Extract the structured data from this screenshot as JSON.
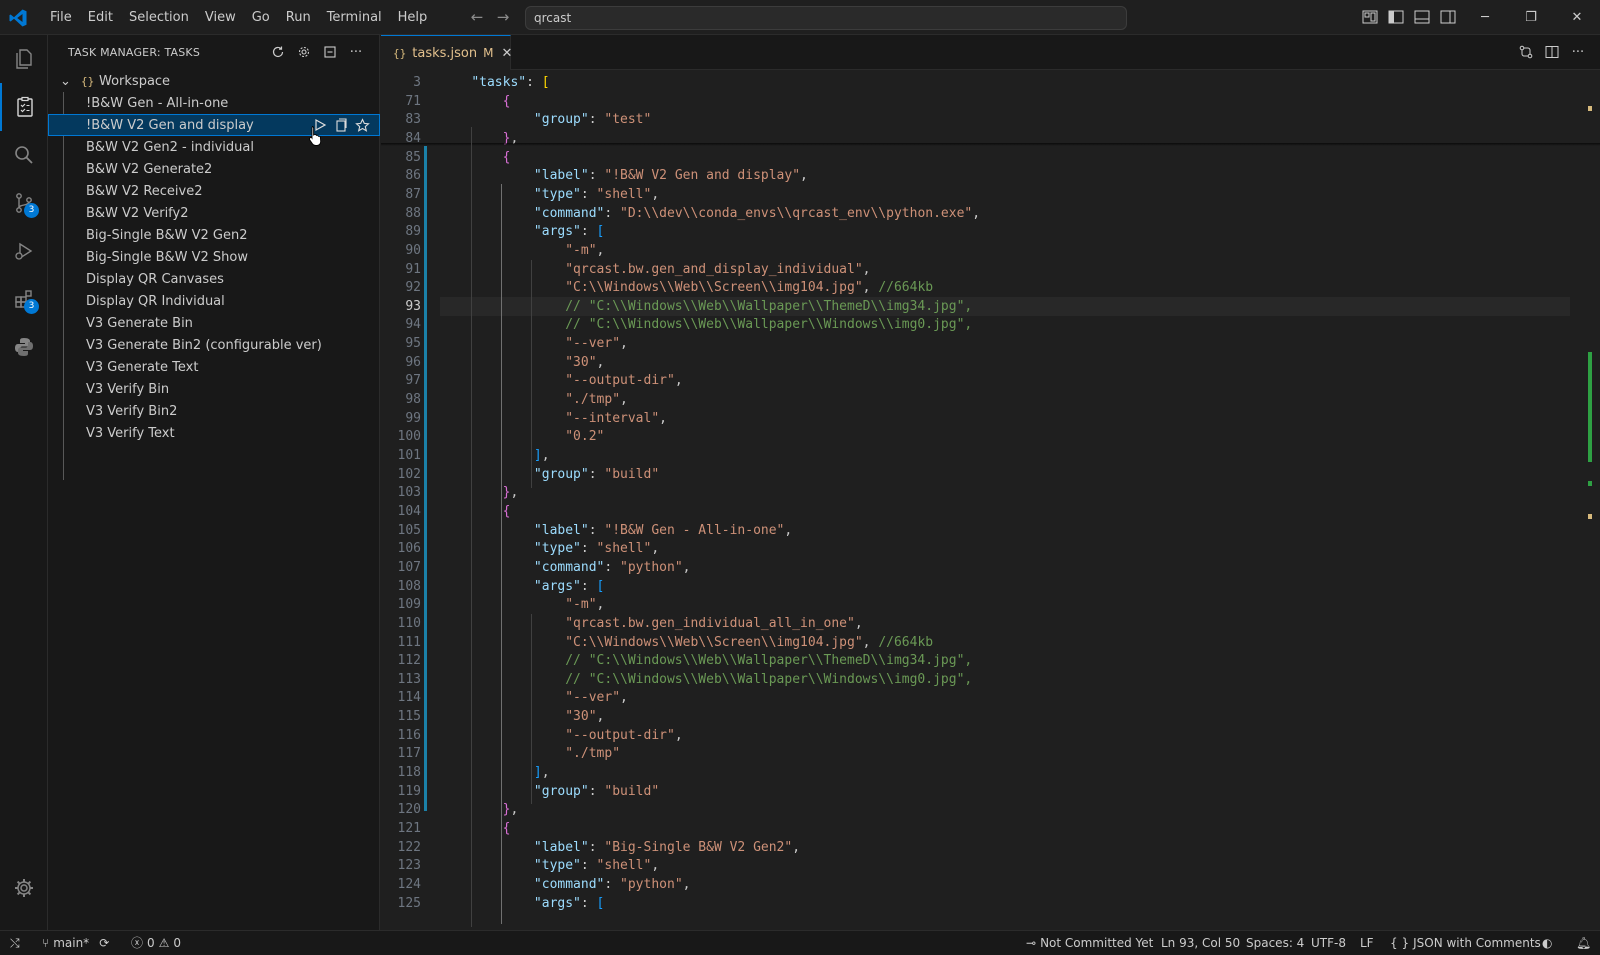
{
  "menu": [
    "File",
    "Edit",
    "Selection",
    "View",
    "Go",
    "Run",
    "Terminal",
    "Help"
  ],
  "search": {
    "value": "qrcast"
  },
  "colors": {
    "accent": "#0078d4",
    "background": "#1f1f1f",
    "sidebar": "#181818",
    "modified": "#e2c08d",
    "selection": "#04395e"
  },
  "activitybar": {
    "items": [
      {
        "name": "explorer-icon"
      },
      {
        "name": "task-manager-icon",
        "active": true
      },
      {
        "name": "search-icon"
      },
      {
        "name": "source-control-icon",
        "badge": "3"
      },
      {
        "name": "run-debug-icon"
      },
      {
        "name": "extensions-icon",
        "badge": "3"
      },
      {
        "name": "python-icon"
      }
    ],
    "settings": "gear-icon"
  },
  "sidebar": {
    "title": "TASK MANAGER: TASKS",
    "root": "Workspace",
    "tasks": [
      "!B&W Gen - All-in-one",
      "!B&W V2 Gen and display",
      "B&W V2 Gen2 - individual",
      "B&W V2 Generate2",
      "B&W V2 Receive2",
      "B&W V2 Verify2",
      "Big-Single B&W V2 Gen2",
      "Big-Single B&W V2 Show",
      "Display QR Canvases",
      "Display QR Individual",
      "V3 Generate Bin",
      "V3 Generate Bin2 (configurable ver)",
      "V3 Generate Text",
      "V3 Verify Bin",
      "V3 Verify Bin2",
      "V3 Verify Text"
    ],
    "selected_index": 1
  },
  "editor": {
    "tab": {
      "icon": "{}",
      "name": "tasks.json",
      "status": "M"
    },
    "current_line": 93,
    "lines": [
      {
        "n": "3",
        "segs": [
          [
            "p",
            "    "
          ],
          [
            "k",
            "\"tasks\""
          ],
          [
            "p",
            ": "
          ],
          [
            "b1",
            "["
          ]
        ]
      },
      {
        "n": "71",
        "segs": [
          [
            "p",
            "        "
          ],
          [
            "b2",
            "{"
          ]
        ]
      },
      {
        "n": "83",
        "segs": [
          [
            "p",
            "            "
          ],
          [
            "k",
            "\"group\""
          ],
          [
            "p",
            ": "
          ],
          [
            "s",
            "\"test\""
          ]
        ]
      },
      {
        "n": "84",
        "segs": [
          [
            "p",
            "        "
          ],
          [
            "b2",
            "}"
          ],
          [
            "p",
            ","
          ]
        ]
      },
      {
        "n": "85",
        "segs": [
          [
            "p",
            "        "
          ],
          [
            "b2",
            "{"
          ]
        ]
      },
      {
        "n": "86",
        "segs": [
          [
            "p",
            "            "
          ],
          [
            "k",
            "\"label\""
          ],
          [
            "p",
            ": "
          ],
          [
            "s",
            "\"!B&W V2 Gen and display\""
          ],
          [
            "p",
            ","
          ]
        ]
      },
      {
        "n": "87",
        "segs": [
          [
            "p",
            "            "
          ],
          [
            "k",
            "\"type\""
          ],
          [
            "p",
            ": "
          ],
          [
            "s",
            "\"shell\""
          ],
          [
            "p",
            ","
          ]
        ]
      },
      {
        "n": "88",
        "segs": [
          [
            "p",
            "            "
          ],
          [
            "k",
            "\"command\""
          ],
          [
            "p",
            ": "
          ],
          [
            "s",
            "\"D:\\\\dev\\\\conda_envs\\\\qrcast_env\\\\python.exe\""
          ],
          [
            "p",
            ","
          ]
        ]
      },
      {
        "n": "89",
        "segs": [
          [
            "p",
            "            "
          ],
          [
            "k",
            "\"args\""
          ],
          [
            "p",
            ": "
          ],
          [
            "b3",
            "["
          ]
        ]
      },
      {
        "n": "90",
        "segs": [
          [
            "p",
            "                "
          ],
          [
            "s",
            "\"-m\""
          ],
          [
            "p",
            ","
          ]
        ]
      },
      {
        "n": "91",
        "segs": [
          [
            "p",
            "                "
          ],
          [
            "s",
            "\"qrcast.bw.gen_and_display_individual\""
          ],
          [
            "p",
            ","
          ]
        ]
      },
      {
        "n": "92",
        "segs": [
          [
            "p",
            "                "
          ],
          [
            "s",
            "\"C:\\\\Windows\\\\Web\\\\Screen\\\\img104.jpg\""
          ],
          [
            "p",
            ", "
          ],
          [
            "c",
            "//664kb"
          ]
        ]
      },
      {
        "n": "93",
        "segs": [
          [
            "p",
            "                "
          ],
          [
            "c",
            "// \"C:\\\\Windows\\\\Web\\\\Wallpaper\\\\ThemeD\\\\img34.jpg\","
          ]
        ]
      },
      {
        "n": "94",
        "segs": [
          [
            "p",
            "                "
          ],
          [
            "c",
            "// \"C:\\\\Windows\\\\Web\\\\Wallpaper\\\\Windows\\\\img0.jpg\","
          ]
        ]
      },
      {
        "n": "95",
        "segs": [
          [
            "p",
            "                "
          ],
          [
            "s",
            "\"--ver\""
          ],
          [
            "p",
            ","
          ]
        ]
      },
      {
        "n": "96",
        "segs": [
          [
            "p",
            "                "
          ],
          [
            "s",
            "\"30\""
          ],
          [
            "p",
            ","
          ]
        ]
      },
      {
        "n": "97",
        "segs": [
          [
            "p",
            "                "
          ],
          [
            "s",
            "\"--output-dir\""
          ],
          [
            "p",
            ","
          ]
        ]
      },
      {
        "n": "98",
        "segs": [
          [
            "p",
            "                "
          ],
          [
            "s",
            "\"./tmp\""
          ],
          [
            "p",
            ","
          ]
        ]
      },
      {
        "n": "99",
        "segs": [
          [
            "p",
            "                "
          ],
          [
            "s",
            "\"--interval\""
          ],
          [
            "p",
            ","
          ]
        ]
      },
      {
        "n": "100",
        "segs": [
          [
            "p",
            "                "
          ],
          [
            "s",
            "\"0.2\""
          ]
        ]
      },
      {
        "n": "101",
        "segs": [
          [
            "p",
            "            "
          ],
          [
            "b3",
            "]"
          ],
          [
            "p",
            ","
          ]
        ]
      },
      {
        "n": "102",
        "segs": [
          [
            "p",
            "            "
          ],
          [
            "k",
            "\"group\""
          ],
          [
            "p",
            ": "
          ],
          [
            "s",
            "\"build\""
          ]
        ]
      },
      {
        "n": "103",
        "segs": [
          [
            "p",
            "        "
          ],
          [
            "b2",
            "}"
          ],
          [
            "p",
            ","
          ]
        ]
      },
      {
        "n": "104",
        "segs": [
          [
            "p",
            "        "
          ],
          [
            "b2",
            "{"
          ]
        ]
      },
      {
        "n": "105",
        "segs": [
          [
            "p",
            "            "
          ],
          [
            "k",
            "\"label\""
          ],
          [
            "p",
            ": "
          ],
          [
            "s",
            "\"!B&W Gen - All-in-one\""
          ],
          [
            "p",
            ","
          ]
        ]
      },
      {
        "n": "106",
        "segs": [
          [
            "p",
            "            "
          ],
          [
            "k",
            "\"type\""
          ],
          [
            "p",
            ": "
          ],
          [
            "s",
            "\"shell\""
          ],
          [
            "p",
            ","
          ]
        ]
      },
      {
        "n": "107",
        "segs": [
          [
            "p",
            "            "
          ],
          [
            "k",
            "\"command\""
          ],
          [
            "p",
            ": "
          ],
          [
            "s",
            "\"python\""
          ],
          [
            "p",
            ","
          ]
        ]
      },
      {
        "n": "108",
        "segs": [
          [
            "p",
            "            "
          ],
          [
            "k",
            "\"args\""
          ],
          [
            "p",
            ": "
          ],
          [
            "b3",
            "["
          ]
        ]
      },
      {
        "n": "109",
        "segs": [
          [
            "p",
            "                "
          ],
          [
            "s",
            "\"-m\""
          ],
          [
            "p",
            ","
          ]
        ]
      },
      {
        "n": "110",
        "segs": [
          [
            "p",
            "                "
          ],
          [
            "s",
            "\"qrcast.bw.gen_individual_all_in_one\""
          ],
          [
            "p",
            ","
          ]
        ]
      },
      {
        "n": "111",
        "segs": [
          [
            "p",
            "                "
          ],
          [
            "s",
            "\"C:\\\\Windows\\\\Web\\\\Screen\\\\img104.jpg\""
          ],
          [
            "p",
            ", "
          ],
          [
            "c",
            "//664kb"
          ]
        ]
      },
      {
        "n": "112",
        "segs": [
          [
            "p",
            "                "
          ],
          [
            "c",
            "// \"C:\\\\Windows\\\\Web\\\\Wallpaper\\\\ThemeD\\\\img34.jpg\","
          ]
        ]
      },
      {
        "n": "113",
        "segs": [
          [
            "p",
            "                "
          ],
          [
            "c",
            "// \"C:\\\\Windows\\\\Web\\\\Wallpaper\\\\Windows\\\\img0.jpg\","
          ]
        ]
      },
      {
        "n": "114",
        "segs": [
          [
            "p",
            "                "
          ],
          [
            "s",
            "\"--ver\""
          ],
          [
            "p",
            ","
          ]
        ]
      },
      {
        "n": "115",
        "segs": [
          [
            "p",
            "                "
          ],
          [
            "s",
            "\"30\""
          ],
          [
            "p",
            ","
          ]
        ]
      },
      {
        "n": "116",
        "segs": [
          [
            "p",
            "                "
          ],
          [
            "s",
            "\"--output-dir\""
          ],
          [
            "p",
            ","
          ]
        ]
      },
      {
        "n": "117",
        "segs": [
          [
            "p",
            "                "
          ],
          [
            "s",
            "\"./tmp\""
          ]
        ]
      },
      {
        "n": "118",
        "segs": [
          [
            "p",
            "            "
          ],
          [
            "b3",
            "]"
          ],
          [
            "p",
            ","
          ]
        ]
      },
      {
        "n": "119",
        "segs": [
          [
            "p",
            "            "
          ],
          [
            "k",
            "\"group\""
          ],
          [
            "p",
            ": "
          ],
          [
            "s",
            "\"build\""
          ]
        ]
      },
      {
        "n": "120",
        "segs": [
          [
            "p",
            "        "
          ],
          [
            "b2",
            "}"
          ],
          [
            "p",
            ","
          ]
        ]
      },
      {
        "n": "121",
        "segs": [
          [
            "p",
            "        "
          ],
          [
            "b2",
            "{"
          ]
        ]
      },
      {
        "n": "122",
        "segs": [
          [
            "p",
            "            "
          ],
          [
            "k",
            "\"label\""
          ],
          [
            "p",
            ": "
          ],
          [
            "s",
            "\"Big-Single B&W V2 Gen2\""
          ],
          [
            "p",
            ","
          ]
        ]
      },
      {
        "n": "123",
        "segs": [
          [
            "p",
            "            "
          ],
          [
            "k",
            "\"type\""
          ],
          [
            "p",
            ": "
          ],
          [
            "s",
            "\"shell\""
          ],
          [
            "p",
            ","
          ]
        ]
      },
      {
        "n": "124",
        "segs": [
          [
            "p",
            "            "
          ],
          [
            "k",
            "\"command\""
          ],
          [
            "p",
            ": "
          ],
          [
            "s",
            "\"python\""
          ],
          [
            "p",
            ","
          ]
        ]
      },
      {
        "n": "125",
        "segs": [
          [
            "p",
            "            "
          ],
          [
            "k",
            "\"args\""
          ],
          [
            "p",
            ": "
          ],
          [
            "b3",
            "["
          ]
        ]
      }
    ]
  },
  "statusbar": {
    "branch": "main*",
    "errors": "0",
    "warnings": "0",
    "blame": "Not Committed Yet",
    "position": "Ln 93, Col 50",
    "spaces": "Spaces: 4",
    "encoding": "UTF-8",
    "eol": "LF",
    "language": "JSON with Comments"
  }
}
